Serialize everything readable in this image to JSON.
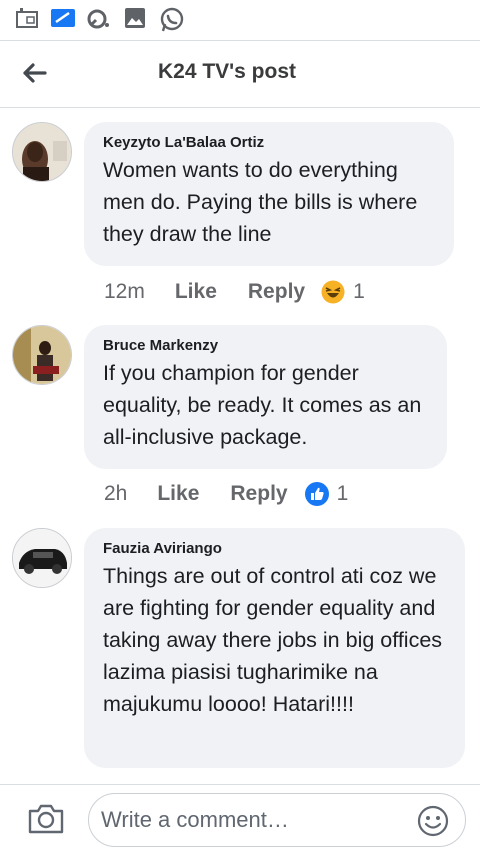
{
  "status_bar": {
    "icons": [
      "calendar-icon",
      "screen-icon",
      "sync-icon",
      "gallery-icon",
      "whatsapp-icon"
    ]
  },
  "header": {
    "title": "K24 TV's post",
    "back_icon": "arrow-left-icon"
  },
  "comments": [
    {
      "author": "Keyzyto La'Balaa Ortiz",
      "text": "Women wants to do everything men do. Paying the bills is where they draw the line",
      "time": "12m",
      "like_label": "Like",
      "reply_label": "Reply",
      "reaction": "haha",
      "reaction_count": "1"
    },
    {
      "author": "Bruce Markenzy",
      "text": "If you champion for gender equality, be ready. It comes as an all-inclusive package.",
      "time": "2h",
      "like_label": "Like",
      "reply_label": "Reply",
      "reaction": "like",
      "reaction_count": "1"
    },
    {
      "author": "Fauzia Aviriango",
      "text": "Things are out of control ati coz we are fighting for gender equality and taking away there jobs in big offices lazima piasisi tugharimike na majukumu loooo! Hatari!!!!"
    }
  ],
  "composer": {
    "placeholder": "Write a comment…",
    "camera_icon": "camera-icon",
    "emoji_icon": "smiley-icon"
  },
  "colors": {
    "bubble_bg": "#f0f2f5",
    "meta_text": "#65676b",
    "like_blue": "#1877f2",
    "haha_yellow": "#f7b125",
    "whatsapp_green": "#25d366"
  }
}
